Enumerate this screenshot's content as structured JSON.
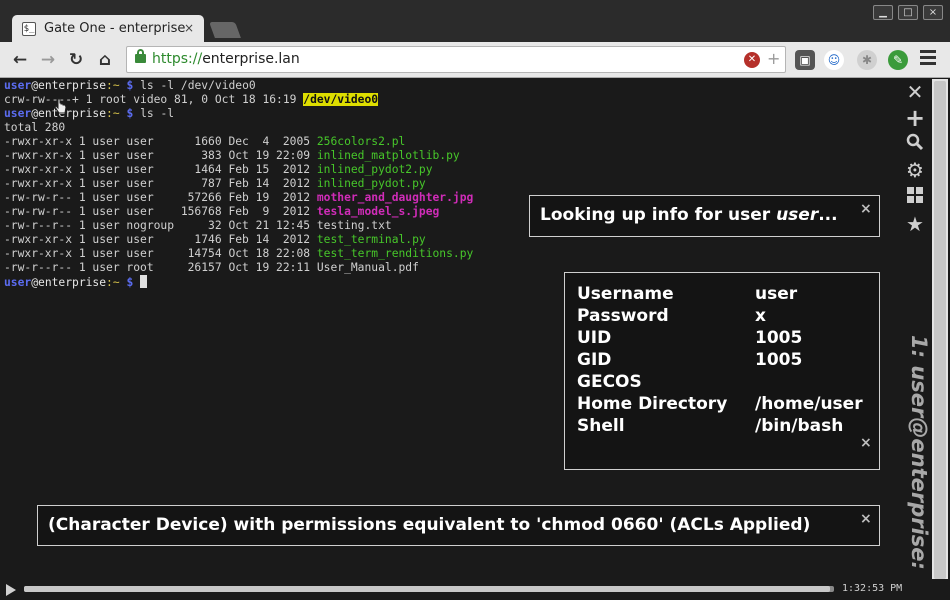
{
  "browser": {
    "tab_title": "Gate One - enterprise",
    "tab_favicon": "$_",
    "url_scheme": "https://",
    "url_host": "enterprise.lan",
    "window_controls": [
      "minimize-icon",
      "maximize-icon",
      "close-icon"
    ],
    "nav_icons": [
      "back-arrow-icon",
      "forward-arrow-icon",
      "reload-icon",
      "home-icon"
    ]
  },
  "terminal": {
    "prompt": {
      "user": "user",
      "host": "@enterprise",
      "path": ":~",
      "symbol": "$"
    },
    "lines": [
      {
        "type": "prompt",
        "command": "ls -l /dev/video0"
      },
      {
        "type": "out",
        "segments": [
          {
            "text": "crw-rw----+ 1 root video 81, 0 Oct 18 16:19 ",
            "style": "plain"
          },
          {
            "text": "/dev/video0",
            "style": "hl-yellow"
          }
        ]
      },
      {
        "type": "prompt",
        "command": "ls -l"
      },
      {
        "type": "out",
        "segments": [
          {
            "text": "total 280",
            "style": "plain"
          }
        ]
      },
      {
        "type": "out",
        "segments": [
          {
            "text": "-rwxr-xr-x 1 user user      1660 Dec  4  2005 ",
            "style": "plain"
          },
          {
            "text": "256colors2.pl",
            "style": "fg-green"
          }
        ]
      },
      {
        "type": "out",
        "segments": [
          {
            "text": "-rwxr-xr-x 1 user user       383 Oct 19 22:09 ",
            "style": "plain"
          },
          {
            "text": "inlined_matplotlib.py",
            "style": "fg-green"
          }
        ]
      },
      {
        "type": "out",
        "segments": [
          {
            "text": "-rwxr-xr-x 1 user user      1464 Feb 15  2012 ",
            "style": "plain"
          },
          {
            "text": "inlined_pydot2.py",
            "style": "fg-green"
          }
        ]
      },
      {
        "type": "out",
        "segments": [
          {
            "text": "-rwxr-xr-x 1 user user       787 Feb 14  2012 ",
            "style": "plain"
          },
          {
            "text": "inlined_pydot.py",
            "style": "fg-green"
          }
        ]
      },
      {
        "type": "out",
        "segments": [
          {
            "text": "-rw-rw-r-- 1 user user     57266 Feb 19  2012 ",
            "style": "plain"
          },
          {
            "text": "mother_and_daughter.jpg",
            "style": "fg-magenta"
          }
        ]
      },
      {
        "type": "out",
        "segments": [
          {
            "text": "-rw-rw-r-- 1 user user    156768 Feb  9  2012 ",
            "style": "plain"
          },
          {
            "text": "tesla_model_s.jpeg",
            "style": "fg-magenta"
          }
        ]
      },
      {
        "type": "out",
        "segments": [
          {
            "text": "-rw-r--r-- 1 user nogroup     32 Oct 21 12:45 ",
            "style": "plain"
          },
          {
            "text": "testing.txt",
            "style": "plain"
          }
        ]
      },
      {
        "type": "out",
        "segments": [
          {
            "text": "-rwxr-xr-x 1 user user      1746 Feb 14  2012 ",
            "style": "plain"
          },
          {
            "text": "test_terminal.py",
            "style": "fg-green"
          }
        ]
      },
      {
        "type": "out",
        "segments": [
          {
            "text": "-rwxr-xr-x 1 user user     14754 Oct 18 22:08 ",
            "style": "plain"
          },
          {
            "text": "test_term_renditions.py",
            "style": "fg-green"
          }
        ]
      },
      {
        "type": "out",
        "segments": [
          {
            "text": "-rw-r--r-- 1 user root     26157 Oct 19 22:11 ",
            "style": "plain"
          },
          {
            "text": "User_Manual.pdf",
            "style": "plain"
          }
        ]
      },
      {
        "type": "prompt",
        "command": "",
        "cursor": true
      }
    ]
  },
  "sidebar": {
    "icons": [
      "close-icon",
      "new-terminal-icon",
      "search-icon",
      "settings-gear-icon",
      "grid-view-icon",
      "bookmark-star-icon"
    ],
    "terminal_title": "1: user@enterprise: ~"
  },
  "lookup_toast": {
    "prefix": "Looking up info for user ",
    "user": "user",
    "suffix": "..."
  },
  "userinfo": {
    "rows": [
      {
        "key": "Username",
        "value": "user"
      },
      {
        "key": "Password",
        "value": "x"
      },
      {
        "key": "UID",
        "value": "1005"
      },
      {
        "key": "GID",
        "value": "1005"
      },
      {
        "key": "GECOS",
        "value": ""
      },
      {
        "key": "Home Directory",
        "value": "/home/user"
      },
      {
        "key": "Shell",
        "value": "/bin/bash"
      }
    ]
  },
  "device_toast": {
    "text": "(Character Device) with permissions equivalent to 'chmod 0660' (ACLs Applied)"
  },
  "playback": {
    "time": "1:32:53 PM",
    "progress": 0.995
  },
  "close_glyph": "×"
}
